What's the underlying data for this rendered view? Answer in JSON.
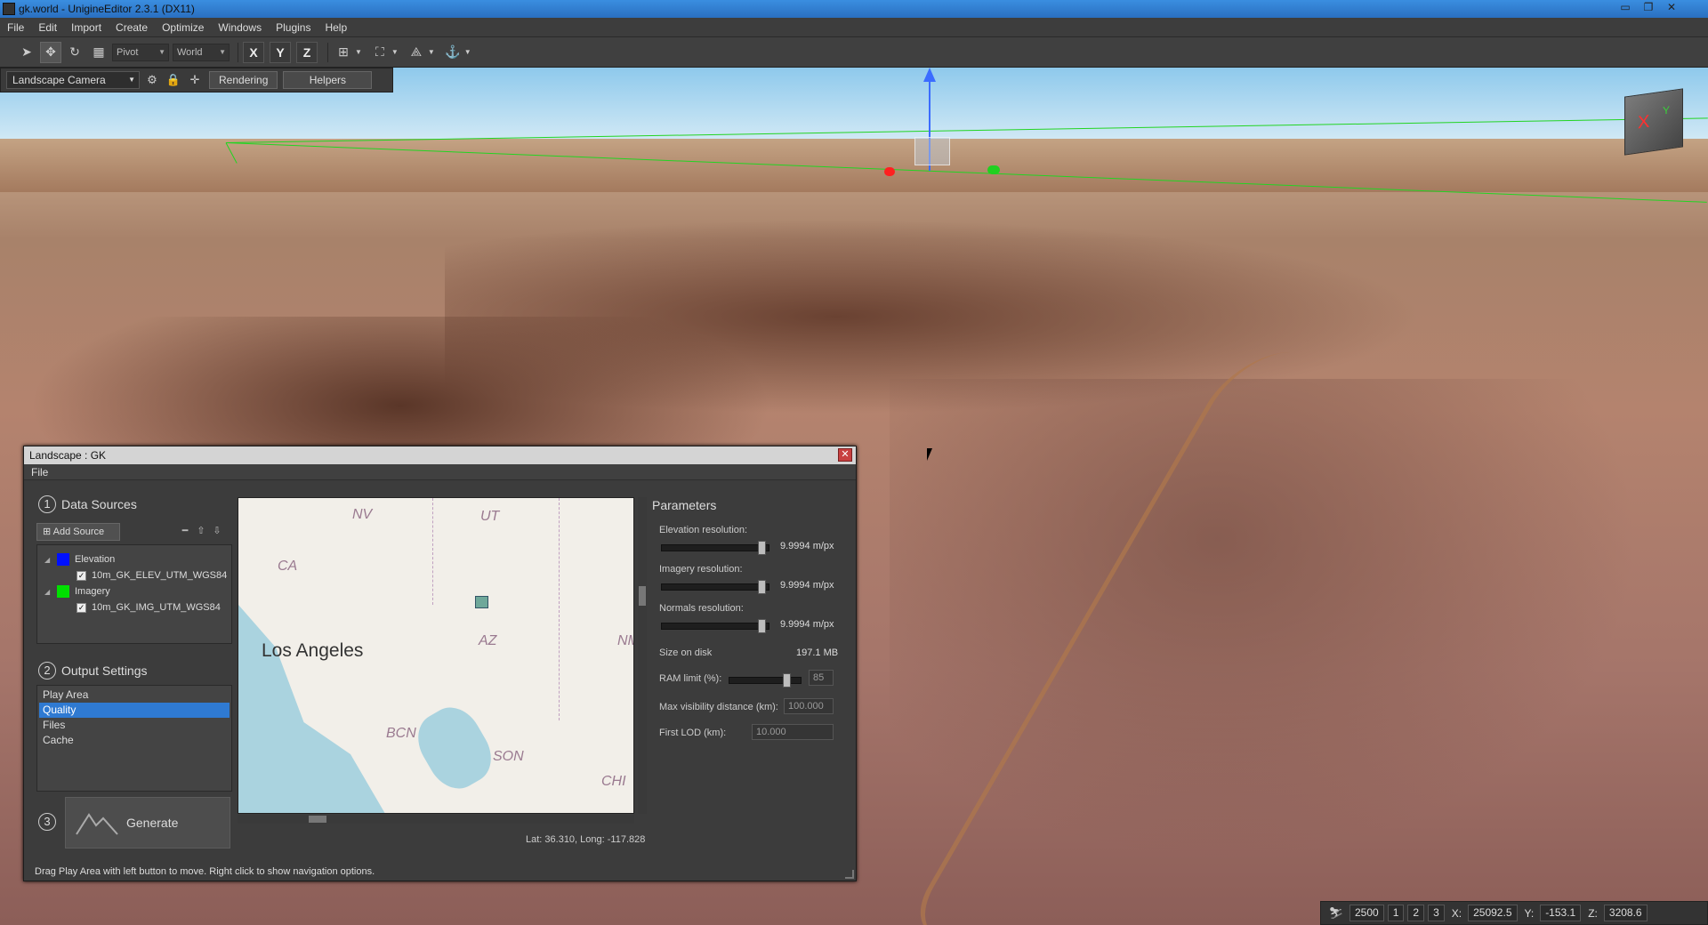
{
  "window": {
    "title": "gk.world - UnigineEditor 2.3.1 (DX11)",
    "controls": [
      "▭",
      "❐",
      "✕"
    ]
  },
  "menu": [
    "File",
    "Edit",
    "Import",
    "Create",
    "Optimize",
    "Windows",
    "Plugins",
    "Help"
  ],
  "toolbar": {
    "pivot_value": "Pivot",
    "space_value": "World",
    "axes": [
      "X",
      "Y",
      "Z"
    ]
  },
  "camera_toolbar": {
    "camera_value": "Landscape Camera",
    "rendering_label": "Rendering",
    "helpers_label": "Helpers"
  },
  "dialog": {
    "title": "Landscape : GK",
    "menu_file": "File",
    "step1": {
      "num": "1",
      "label": "Data Sources"
    },
    "add_source_label": "Add Source",
    "sources": [
      {
        "name": "Elevation",
        "color": "#0010ff",
        "file": "10m_GK_ELEV_UTM_WGS84"
      },
      {
        "name": "Imagery",
        "color": "#00e000",
        "file": "10m_GK_IMG_UTM_WGS84"
      }
    ],
    "step2": {
      "num": "2",
      "label": "Output Settings"
    },
    "output_items": [
      "Play Area",
      "Quality",
      "Files",
      "Cache"
    ],
    "output_selected": "Quality",
    "step3": {
      "num": "3"
    },
    "generate_label": "Generate",
    "map": {
      "states": [
        "NV",
        "UT",
        "CA",
        "AZ",
        "NM",
        "BCN",
        "SON",
        "CHI"
      ],
      "city": "Los Angeles"
    },
    "latlong": "Lat: 36.310, Long: -117.828",
    "parameters": {
      "title": "Parameters",
      "elevation_label": "Elevation resolution:",
      "elevation_value": "9.9994 m/px",
      "elevation_level": 0.97,
      "imagery_label": "Imagery resolution:",
      "imagery_value": "9.9994 m/px",
      "imagery_level": 0.97,
      "normals_label": "Normals resolution:",
      "normals_value": "9.9994 m/px",
      "normals_level": 0.97,
      "size_label": "Size on disk",
      "size_value": "197.1 MB",
      "ram_label": "RAM limit (%):",
      "ram_value": "85",
      "ram_level": 0.85,
      "maxvis_label": "Max visibility distance (km):",
      "maxvis_value": "100.000",
      "firstlod_label": "First LOD (km):",
      "firstlod_value": "10.000"
    },
    "status": "Drag Play Area with left button to move. Right click to show navigation options."
  },
  "statusbar": {
    "speed": "2500",
    "presets": [
      "1",
      "2",
      "3"
    ],
    "x_label": "X:",
    "x_value": "25092.5",
    "y_label": "Y:",
    "y_value": "-153.1",
    "z_label": "Z:",
    "z_value": "3208.6"
  },
  "navcube": {
    "x": "X",
    "y": "Y"
  }
}
